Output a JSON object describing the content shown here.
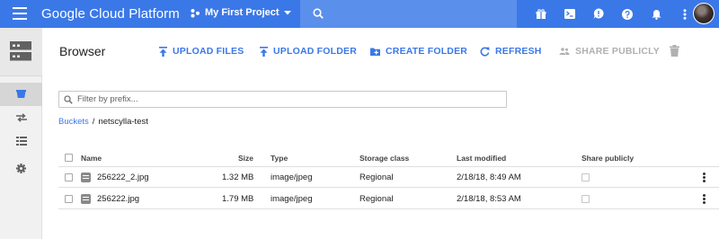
{
  "topbar": {
    "brand": "Google Cloud Platform",
    "project": "My First Project",
    "colors": {
      "bar": "#3b78e7",
      "search": "#5a8fec"
    },
    "icons": [
      "gift-icon",
      "terminal-icon",
      "alert-icon",
      "help-icon",
      "notifications-icon",
      "more-vert-icon"
    ]
  },
  "rail": {
    "items": [
      {
        "icon": "storage-bucket-icon",
        "active": true
      },
      {
        "icon": "transfer-icon",
        "active": false
      },
      {
        "icon": "list-icon",
        "active": false
      },
      {
        "icon": "settings-icon",
        "active": false
      }
    ]
  },
  "header": {
    "title": "Browser",
    "actions": {
      "upload_files": "UPLOAD FILES",
      "upload_folder": "UPLOAD FOLDER",
      "create_folder": "CREATE FOLDER",
      "refresh": "REFRESH",
      "share_publicly": "SHARE PUBLICLY"
    }
  },
  "filter": {
    "placeholder": "Filter by prefix...",
    "value": ""
  },
  "breadcrumb": {
    "root": "Buckets",
    "separator": "/",
    "current": "netscylla-test"
  },
  "table": {
    "columns": {
      "name": "Name",
      "size": "Size",
      "type": "Type",
      "storage_class": "Storage class",
      "last_modified": "Last modified",
      "share_publicly": "Share publicly"
    },
    "rows": [
      {
        "name": "256222_2.jpg",
        "size": "1.32 MB",
        "type": "image/jpeg",
        "storage_class": "Regional",
        "last_modified": "2/18/18, 8:49 AM"
      },
      {
        "name": "256222.jpg",
        "size": "1.79 MB",
        "type": "image/jpeg",
        "storage_class": "Regional",
        "last_modified": "2/18/18, 8:53 AM"
      }
    ]
  }
}
